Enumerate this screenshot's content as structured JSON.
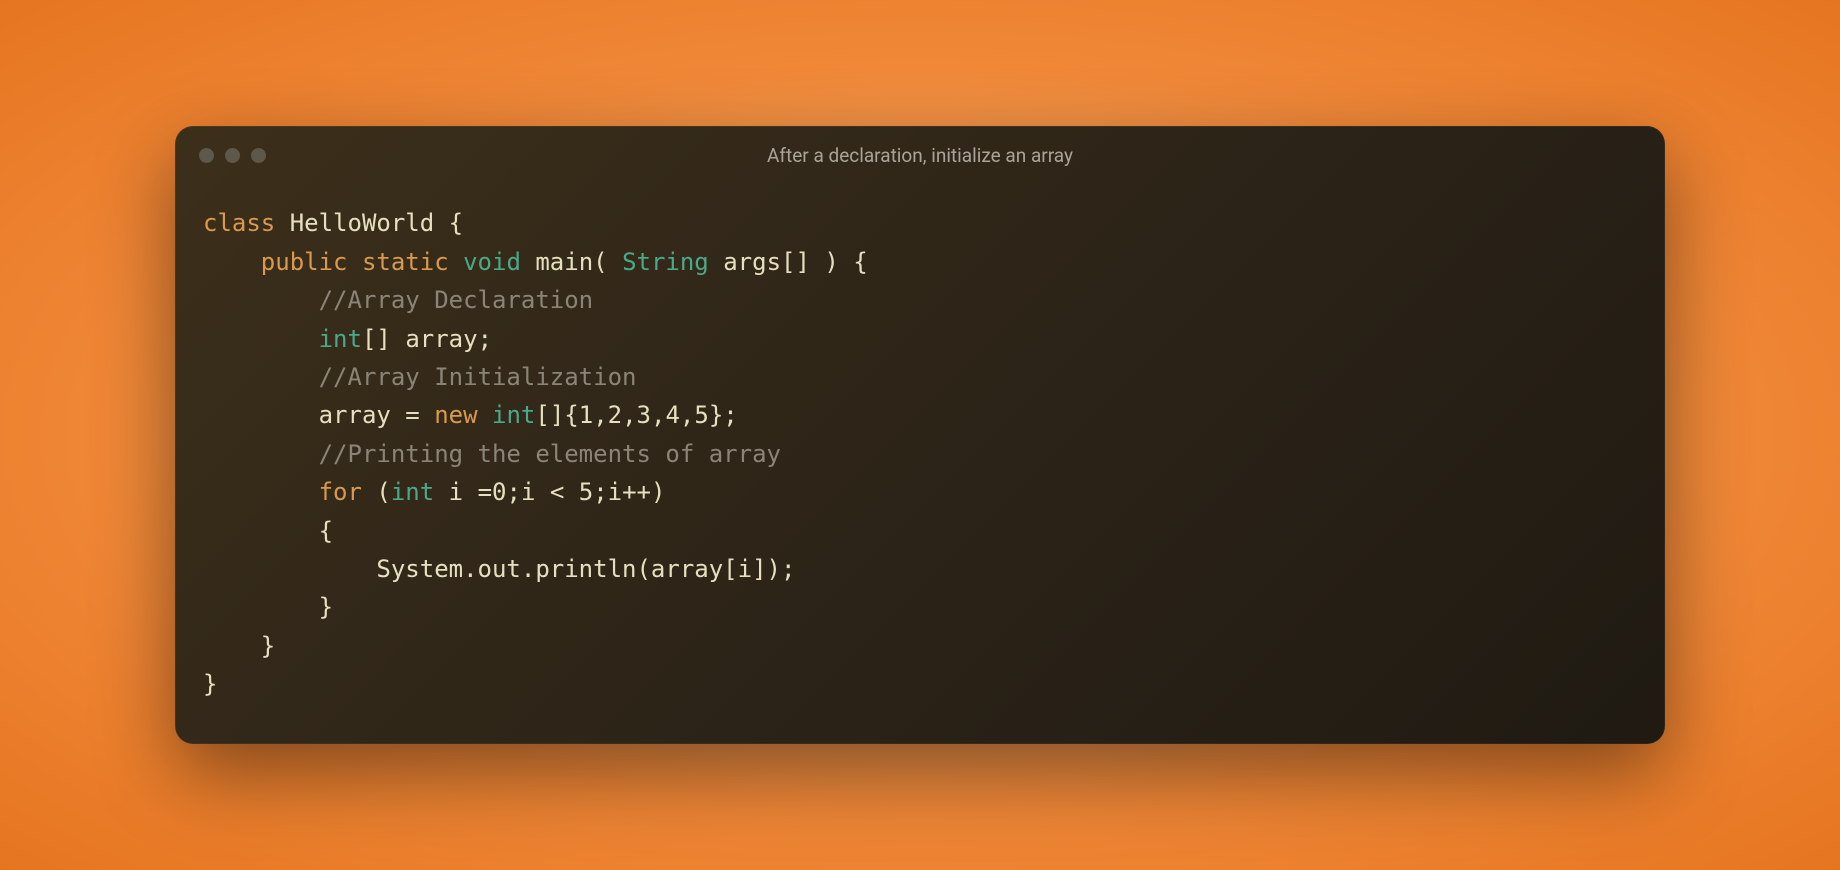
{
  "window": {
    "title": "After a declaration, initialize an array"
  },
  "code": {
    "line1": {
      "kw_class": "class",
      "classname": "HelloWorld",
      "brace": "{"
    },
    "line2": {
      "kw_public": "public",
      "kw_static": "static",
      "kw_void": "void",
      "method": "main",
      "paren_open": "(",
      "type_string": "String",
      "args": "args[]",
      "paren_close": ")",
      "brace": "{"
    },
    "line3": {
      "comment": "//Array Declaration"
    },
    "line4": {
      "kw_int": "int",
      "brackets": "[]",
      "ident": "array",
      "semi": ";"
    },
    "line5": {
      "comment": "//Array Initialization"
    },
    "line6": {
      "ident": "array",
      "eq": "=",
      "kw_new": "new",
      "kw_int": "int",
      "brackets": "[]",
      "brace_open": "{",
      "n1": "1",
      "c1": ",",
      "n2": "2",
      "c2": ",",
      "n3": "3",
      "c3": ",",
      "n4": "4",
      "c4": ",",
      "n5": "5",
      "brace_close": "}",
      "semi": ";"
    },
    "line7": {
      "comment": "//Printing the elements of array"
    },
    "line8": {
      "kw_for": "for",
      "paren_open": "(",
      "kw_int": "int",
      "init": "i =",
      "zero": "0",
      "semi1": ";",
      "cond_i": "i",
      "lt": "<",
      "five": "5",
      "semi2": ";",
      "inc": "i++",
      "paren_close": ")"
    },
    "line9": {
      "brace": "{"
    },
    "line10": {
      "stmt": "System.out.println(array[i]);"
    },
    "line11": {
      "brace": "}"
    },
    "line12": {
      "brace": "}"
    },
    "line13": {
      "brace": "}"
    }
  }
}
